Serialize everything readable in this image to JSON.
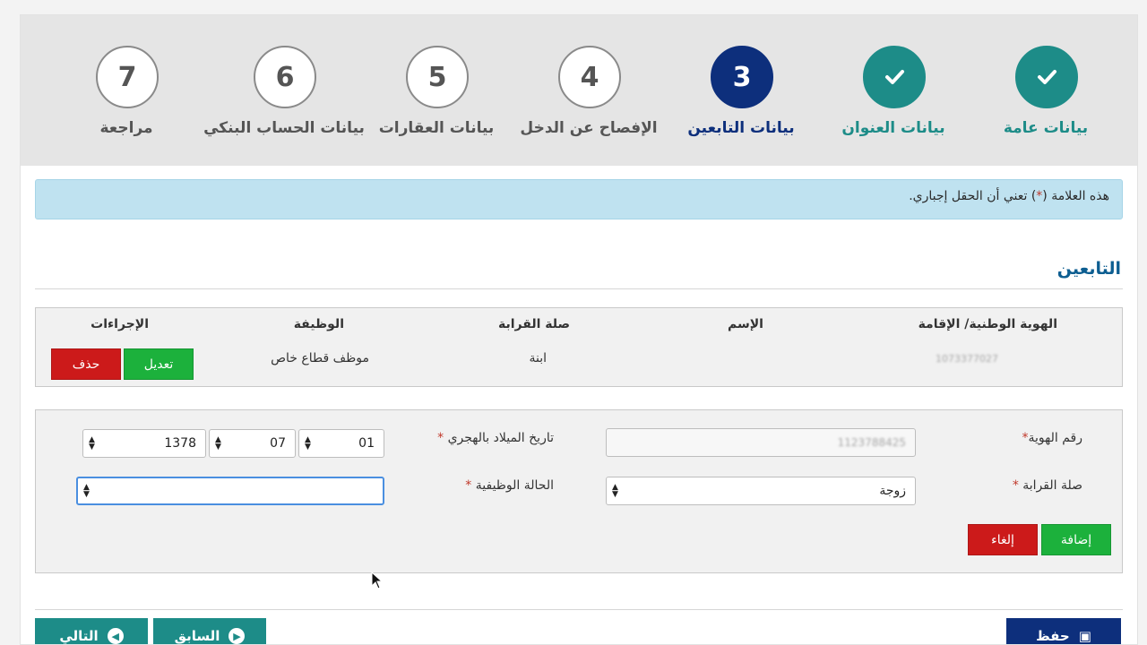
{
  "steps": [
    {
      "number": "",
      "label": "بيانات عامة",
      "state": "done",
      "icon": "check-icon"
    },
    {
      "number": "",
      "label": "بيانات العنوان",
      "state": "done",
      "icon": "check-icon"
    },
    {
      "number": "3",
      "label": "بيانات التابعين",
      "state": "active"
    },
    {
      "number": "4",
      "label": "الإفصاح عن الدخل",
      "state": "pending"
    },
    {
      "number": "5",
      "label": "بيانات العقارات",
      "state": "pending"
    },
    {
      "number": "6",
      "label": "بيانات الحساب البنكي",
      "state": "pending"
    },
    {
      "number": "7",
      "label": "مراجعة",
      "state": "pending"
    }
  ],
  "alert": {
    "before": "هذه العلامة (",
    "star": "*",
    "after": ") تعني أن الحقل إجباري."
  },
  "section_title": "التابعين",
  "table": {
    "headers": {
      "id": "الهوية الوطنية/ الإقامة",
      "name": "الإسم",
      "relation": "صلة القرابة",
      "job": "الوظيفة",
      "actions": "الإجراءات"
    },
    "rows": [
      {
        "id": "1073377027",
        "name": "",
        "relation": "ابنة",
        "job": "موظف قطاع خاص",
        "edit_label": "تعديل",
        "delete_label": "حذف"
      }
    ]
  },
  "form": {
    "id_label": "رقم الهوية",
    "id_value": "1123788425",
    "birth_label": "تاريخ الميلاد بالهجري",
    "birth_day": "01",
    "birth_month": "07",
    "birth_year": "1378",
    "relation_label": "صلة القرابة",
    "relation_value": "زوجة",
    "employment_label": "الحالة الوظيفية",
    "employment_value": "",
    "add_label": "إضافة",
    "cancel_label": "إلغاء",
    "required_mark": "*"
  },
  "footer": {
    "next_label": "التالي",
    "prev_label": "السابق",
    "save_label": "حفظ"
  },
  "colors": {
    "done": "#1d8c88",
    "active": "#0d2f7c",
    "green": "#1cb13c",
    "red": "#cc1a1a"
  }
}
